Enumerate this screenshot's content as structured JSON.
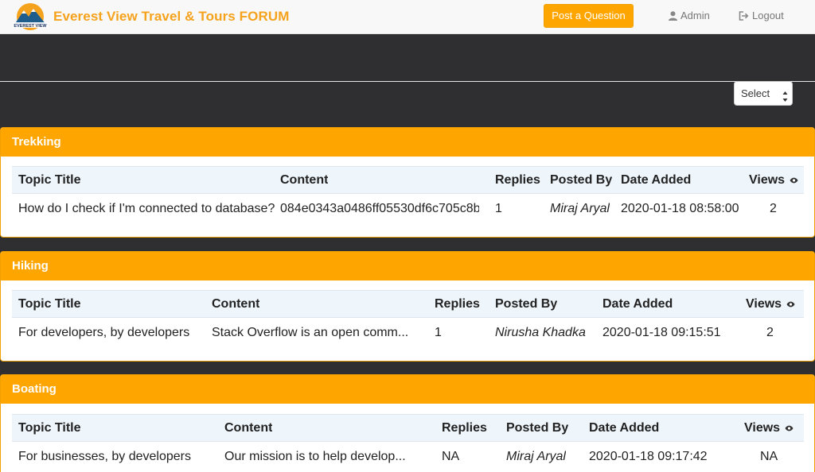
{
  "navbar": {
    "brand": "Everest View Travel & Tours FORUM",
    "logo_text": "EVEREST VIEW",
    "post_button": "Post a Question",
    "admin": "Admin",
    "logout": "Logout"
  },
  "filter": {
    "select_value": "Select"
  },
  "columns_label": {
    "title": "Topic Title",
    "content": "Content",
    "replies": "Replies",
    "posted_by": "Posted By",
    "date": "Date Added",
    "views": "Views"
  },
  "categories": [
    {
      "name": "Trekking",
      "rows": [
        {
          "title": "How do I check if I'm connected to database?",
          "content": "084e0343a0486ff05530df6c705c8b...",
          "replies": "1",
          "posted_by": "Miraj Aryal",
          "date": "2020-01-18 08:58:00",
          "views": "2"
        }
      ]
    },
    {
      "name": "Hiking",
      "rows": [
        {
          "title": "For developers, by developers",
          "content": "Stack Overflow is an open comm...",
          "replies": "1",
          "posted_by": "Nirusha Khadka",
          "date": "2020-01-18 09:15:51",
          "views": "2"
        }
      ]
    },
    {
      "name": "Boating",
      "rows": [
        {
          "title": "For businesses, by developers",
          "content": "Our mission is to help develop...",
          "replies": "NA",
          "posted_by": "Miraj Aryal",
          "date": "2020-01-18 09:17:42",
          "views": "NA"
        }
      ]
    }
  ],
  "colors": {
    "accent": "#ffa500",
    "brand_text": "#f5a21d",
    "background": "#2f2f31",
    "table_header": "#eef5fb"
  },
  "icons": [
    "user-icon",
    "logout-icon",
    "eye-icon",
    "logo-icon"
  ]
}
